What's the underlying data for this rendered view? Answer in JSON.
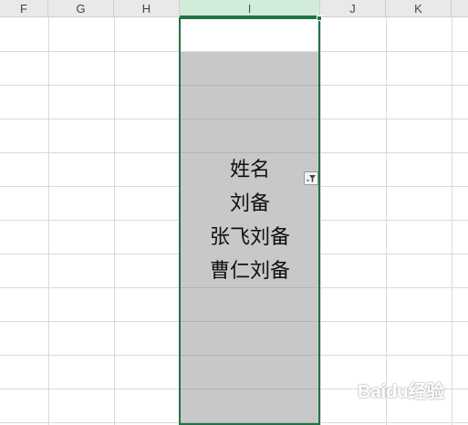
{
  "columns": [
    {
      "label": "F",
      "selected": false
    },
    {
      "label": "G",
      "selected": false
    },
    {
      "label": "H",
      "selected": false
    },
    {
      "label": "I",
      "selected": true
    },
    {
      "label": "J",
      "selected": false
    },
    {
      "label": "K",
      "selected": false
    }
  ],
  "cells": {
    "header": "姓名",
    "row1": "刘备",
    "row2": "张飞刘备",
    "row3": "曹仁刘备"
  },
  "colors": {
    "selection_border": "#217346",
    "filled_background": "#c8c8c8",
    "header_selected_background": "#d3ecd9"
  },
  "icons": {
    "filter_button": "filter-dropdown-icon"
  },
  "watermark": {
    "text": "Baidu经验"
  }
}
